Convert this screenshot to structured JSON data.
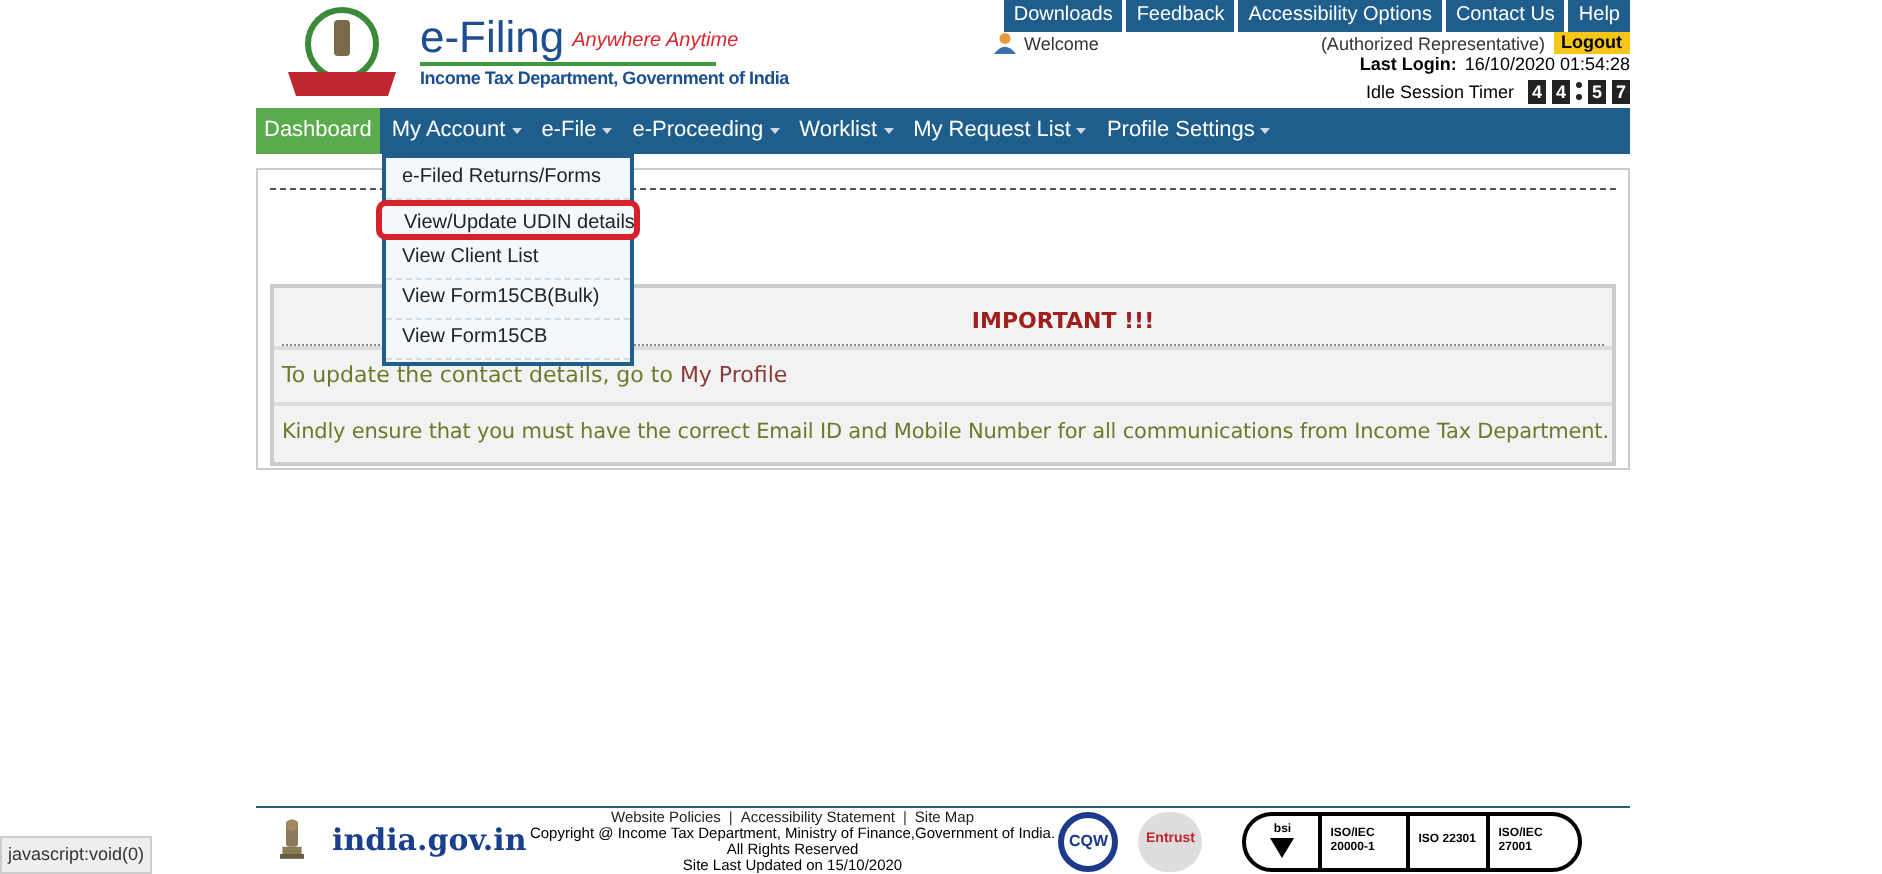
{
  "header": {
    "title": "e-Filing",
    "tagline": "Anywhere Anytime",
    "subtitle": "Income Tax Department, Government of India",
    "top_links": [
      "Downloads",
      "Feedback",
      "Accessibility Options",
      "Contact Us",
      "Help"
    ],
    "welcome": "Welcome",
    "role": "(Authorized Representative)",
    "logout": "Logout",
    "last_login_label": "Last Login:",
    "last_login": "16/10/2020 01:54:28",
    "timer_label": "Idle Session Timer",
    "timer_digits": [
      "4",
      "4",
      "5",
      "7"
    ]
  },
  "nav": [
    {
      "label": "Dashboard",
      "selected": true,
      "caret": false
    },
    {
      "label": "My Account",
      "selected": false,
      "caret": true
    },
    {
      "label": "e-File",
      "selected": false,
      "caret": true
    },
    {
      "label": "e-Proceeding",
      "selected": false,
      "caret": true
    },
    {
      "label": "Worklist",
      "selected": false,
      "caret": true
    },
    {
      "label": "My Request List",
      "selected": false,
      "caret": true
    },
    {
      "label": "Profile Settings",
      "selected": false,
      "caret": true
    }
  ],
  "dropdown": [
    {
      "label": "e-Filed Returns/Forms",
      "highlighted": false
    },
    {
      "label": "View/Update UDIN details",
      "highlighted": true
    },
    {
      "label": "View Client List",
      "highlighted": false
    },
    {
      "label": "View Form15CB(Bulk)",
      "highlighted": false
    },
    {
      "label": "View Form15CB",
      "highlighted": false
    }
  ],
  "important": {
    "title": "IMPORTANT !!!",
    "line1": "To update the contact details, go to",
    "link": "My Profile",
    "line2": "Kindly ensure that you must have the correct Email ID and Mobile Number for all communications from Income Tax Department."
  },
  "footer": {
    "portal": "india.gov.in",
    "links": [
      "Website Policies",
      "Accessibility Statement",
      "Site Map"
    ],
    "separator": "|",
    "copyright": "Copyright @ Income Tax Department, Ministry of Finance,Government of India.",
    "rights": "All Rights Reserved",
    "updated": "Site Last Updated on 15/10/2020",
    "badges": [
      "CQW",
      "Entrust",
      "bsi",
      "ISO/IEC 20000-1",
      "ISO 22301",
      "ISO/IEC 27001"
    ]
  },
  "status_bar": "javascript:void(0)"
}
